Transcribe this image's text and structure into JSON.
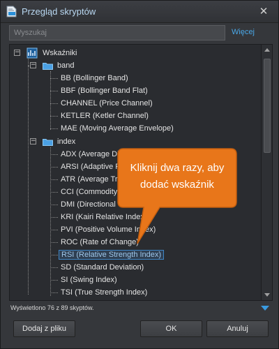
{
  "window": {
    "title": "Przegląd skryptów",
    "title_icon": "script-document-icon",
    "close_icon": "close-icon"
  },
  "search": {
    "placeholder": "Wyszukaj",
    "value": "",
    "more_label": "Więcej"
  },
  "tree": {
    "root": {
      "label": "Wskaźniki",
      "icon": "indicators-icon"
    },
    "groups": [
      {
        "label": "band",
        "icon": "folder-icon",
        "expanded": true,
        "items": [
          "BB (Bollinger Band)",
          "BBF (Bollinger Band Flat)",
          "CHANNEL (Price Channel)",
          "KETLER (Ketler Channel)",
          "MAE (Moving Average Envelope)"
        ]
      },
      {
        "label": "index",
        "icon": "folder-icon",
        "expanded": true,
        "items": [
          "ADX (Average Di",
          "ARSI (Adaptive R",
          "ATR (Average Tru",
          "CCI (Commodity",
          "DMI (Directional",
          "KRI (Kairi Relative Index",
          "PVI (Positive Volume Index)",
          "ROC (Rate of Change)",
          "RSI (Relative Strength Index)",
          "SD (Standard Deviation)",
          "SI (Swing Index)",
          "TSI (True Strength Index)"
        ]
      }
    ],
    "selected": "RSI (Relative Strength Index)"
  },
  "callout": {
    "text": "Kliknij dwa razy, aby dodać wskaźnik",
    "color": "#e8761a"
  },
  "status": {
    "text": "Wyświetlono 76 z 89 skyptów."
  },
  "buttons": {
    "add": "Dodaj z pliku",
    "ok": "OK",
    "cancel": "Anuluj"
  },
  "colors": {
    "accent": "#4aa8e8",
    "title_text": "#b9d8f2",
    "selection_border": "#3f86c6"
  }
}
